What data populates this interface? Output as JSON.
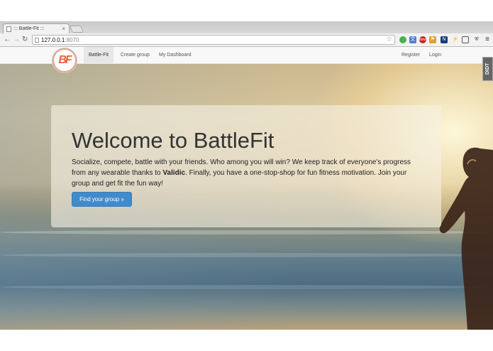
{
  "browser": {
    "tab_title": "::: Battle-Fit :::",
    "address_host": "127.0.0.1",
    "address_port": ":8070",
    "ext_badge": "New"
  },
  "navbar": {
    "logo_text": "BF",
    "links": [
      {
        "label": "Battle-Fit",
        "active": true
      },
      {
        "label": "Create group",
        "active": false
      },
      {
        "label": "My Dashboard",
        "active": false
      }
    ],
    "right_links": [
      {
        "label": "Register"
      },
      {
        "label": "Login"
      }
    ],
    "side_badge": "DIDT"
  },
  "hero": {
    "title": "Welcome to BattleFit",
    "lead_before": "Socialize, compete, battle with your friends. Who among you will win? We keep track of everyone's progress from any wearable thanks to ",
    "lead_bold": "Validic",
    "lead_after": ". Finally, you have a one-stop-shop for fun fitness motivation. Join your group and get fit the fun way!",
    "button_label": "Find your group »"
  },
  "colors": {
    "primary_button": "#428bca",
    "logo_accent": "#e8643a"
  }
}
